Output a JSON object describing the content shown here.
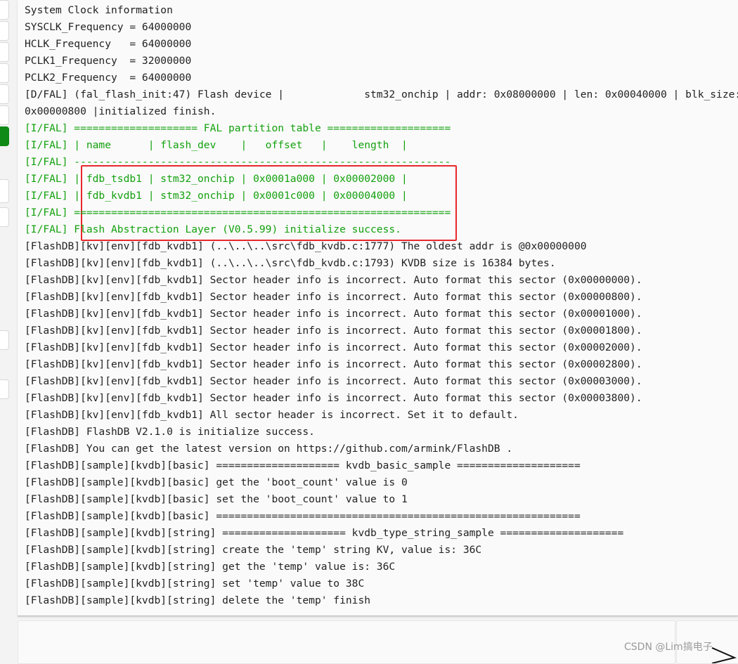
{
  "log_lines": [
    {
      "t": "System Clock information",
      "c": "n"
    },
    {
      "t": "SYSCLK_Frequency = 64000000",
      "c": "n"
    },
    {
      "t": "HCLK_Frequency   = 64000000",
      "c": "n"
    },
    {
      "t": "PCLK1_Frequency  = 32000000",
      "c": "n"
    },
    {
      "t": "PCLK2_Frequency  = 64000000",
      "c": "n"
    },
    {
      "t": "[D/FAL] (fal_flash_init:47) Flash device |             stm32_onchip | addr: 0x08000000 | len: 0x00040000 | blk_size:",
      "c": "n"
    },
    {
      "t": "0x00000800 |initialized finish.",
      "c": "n"
    },
    {
      "t": "[I/FAL] ==================== FAL partition table ====================",
      "c": "g"
    },
    {
      "t": "[I/FAL] | name      | flash_dev    |   offset   |    length  |",
      "c": "g"
    },
    {
      "t": "[I/FAL] -------------------------------------------------------------",
      "c": "g"
    },
    {
      "t": "[I/FAL] | fdb_tsdb1 | stm32_onchip | 0x0001a000 | 0x00002000 |",
      "c": "g"
    },
    {
      "t": "[I/FAL] | fdb_kvdb1 | stm32_onchip | 0x0001c000 | 0x00004000 |",
      "c": "g"
    },
    {
      "t": "[I/FAL] =============================================================",
      "c": "g"
    },
    {
      "t": "[I/FAL] Flash Abstraction Layer (V0.5.99) initialize success.",
      "c": "g"
    },
    {
      "t": "[FlashDB][kv][env][fdb_kvdb1] (..\\..\\..\\src\\fdb_kvdb.c:1777) The oldest addr is @0x00000000",
      "c": "n"
    },
    {
      "t": "[FlashDB][kv][env][fdb_kvdb1] (..\\..\\..\\src\\fdb_kvdb.c:1793) KVDB size is 16384 bytes.",
      "c": "n"
    },
    {
      "t": "[FlashDB][kv][env][fdb_kvdb1] Sector header info is incorrect. Auto format this sector (0x00000000).",
      "c": "n"
    },
    {
      "t": "[FlashDB][kv][env][fdb_kvdb1] Sector header info is incorrect. Auto format this sector (0x00000800).",
      "c": "n"
    },
    {
      "t": "[FlashDB][kv][env][fdb_kvdb1] Sector header info is incorrect. Auto format this sector (0x00001000).",
      "c": "n"
    },
    {
      "t": "[FlashDB][kv][env][fdb_kvdb1] Sector header info is incorrect. Auto format this sector (0x00001800).",
      "c": "n"
    },
    {
      "t": "[FlashDB][kv][env][fdb_kvdb1] Sector header info is incorrect. Auto format this sector (0x00002000).",
      "c": "n"
    },
    {
      "t": "[FlashDB][kv][env][fdb_kvdb1] Sector header info is incorrect. Auto format this sector (0x00002800).",
      "c": "n"
    },
    {
      "t": "[FlashDB][kv][env][fdb_kvdb1] Sector header info is incorrect. Auto format this sector (0x00003000).",
      "c": "n"
    },
    {
      "t": "[FlashDB][kv][env][fdb_kvdb1] Sector header info is incorrect. Auto format this sector (0x00003800).",
      "c": "n"
    },
    {
      "t": "[FlashDB][kv][env][fdb_kvdb1] All sector header is incorrect. Set it to default.",
      "c": "n"
    },
    {
      "t": "[FlashDB] FlashDB V2.1.0 is initialize success.",
      "c": "n"
    },
    {
      "t": "[FlashDB] You can get the latest version on https://github.com/armink/FlashDB .",
      "c": "n"
    },
    {
      "t": "[FlashDB][sample][kvdb][basic] ==================== kvdb_basic_sample ====================",
      "c": "n"
    },
    {
      "t": "[FlashDB][sample][kvdb][basic] get the 'boot_count' value is 0",
      "c": "n"
    },
    {
      "t": "[FlashDB][sample][kvdb][basic] set the 'boot_count' value to 1",
      "c": "n"
    },
    {
      "t": "[FlashDB][sample][kvdb][basic] ===========================================================",
      "c": "n"
    },
    {
      "t": "[FlashDB][sample][kvdb][string] ==================== kvdb_type_string_sample ====================",
      "c": "n"
    },
    {
      "t": "[FlashDB][sample][kvdb][string] create the 'temp' string KV, value is: 36C",
      "c": "n"
    },
    {
      "t": "[FlashDB][sample][kvdb][string] get the 'temp' value is: 36C",
      "c": "n"
    },
    {
      "t": "[FlashDB][sample][kvdb][string] set 'temp' value to 38C",
      "c": "n"
    },
    {
      "t": "[FlashDB][sample][kvdb][string] delete the 'temp' finish",
      "c": "n"
    }
  ],
  "colors": {
    "info_green": "#13a10e",
    "highlight_box": "#e8282b",
    "active_side_button": "#0f8a16"
  },
  "send_icon": "send-arrow-icon",
  "watermark": "CSDN @Lim搞电子"
}
